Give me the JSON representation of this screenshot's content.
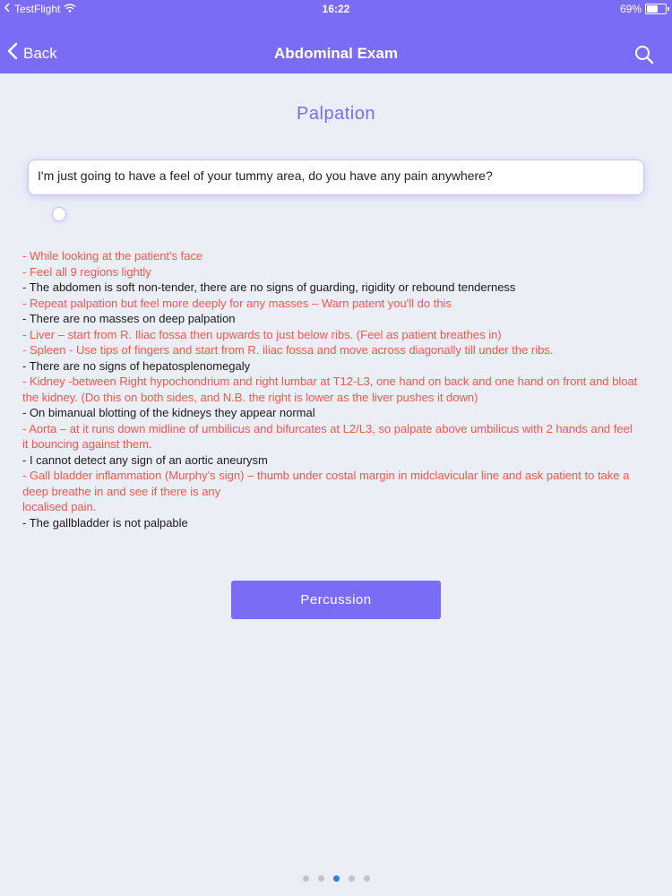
{
  "status_bar": {
    "carrier": "TestFlight",
    "time": "16:22",
    "battery": "69%",
    "battery_level": 0.69
  },
  "nav": {
    "back_label": "Back",
    "title": "Abdominal Exam",
    "search_icon": "search-icon",
    "back_icon": "chevron-left-icon"
  },
  "page": {
    "title": "Palpation",
    "speech": "I'm just going to have a feel of your tummy area, do you have any pain anywhere?"
  },
  "notes": [
    {
      "text": "- While looking at the patient's face",
      "color": "red"
    },
    {
      "text": "- Feel all 9 regions lightly",
      "color": "red"
    },
    {
      "text": "- The abdomen is soft non-tender, there are no signs of guarding, rigidity or rebound tenderness",
      "color": "black"
    },
    {
      "text": "- Repeat palpation but feel more deeply for any masses – Warn patent you'll do this",
      "color": "red"
    },
    {
      "text": "- There are no masses on deep palpation",
      "color": "black"
    },
    {
      "text": "- Liver – start from R. Iliac fossa then upwards to just below ribs. (Feel as patient breathes in)",
      "color": "red"
    },
    {
      "text": "- Spleen - Use tips of fingers and start from R. iliac fossa and move across diagonally till under the ribs.",
      "color": "red"
    },
    {
      "text": "- There are no signs of hepatosplenomegaly",
      "color": "black"
    },
    {
      "text": "- Kidney -between Right hypochondrium and right lumbar at T12-L3, one hand on back and one hand on front and bloat the kidney. (Do this on both sides, and N.B. the right is lower as the liver pushes it down)",
      "color": "red"
    },
    {
      "text": "- On bimanual blotting of the kidneys they appear normal",
      "color": "black"
    },
    {
      "text": "- Aorta – at it runs down midline of umbilicus and bifurcates at L2/L3, so palpate above umbilicus with 2 hands and feel it bouncing against them.",
      "color": "red"
    },
    {
      "text": "- I cannot detect any sign of an aortic aneurysm",
      "color": "black"
    },
    {
      "text": "- Gall bladder inflammation (Murphy's sign) – thumb under costal margin in midclavicular line and ask patient to take a deep breathe in and see if there is any",
      "color": "red"
    },
    {
      "text": "localised pain.",
      "color": "red"
    },
    {
      "text": "- The gallbladder is not palpable",
      "color": "black"
    }
  ],
  "next_button": {
    "label": "Percussion"
  },
  "pager": {
    "count": 5,
    "active_index": 2
  },
  "colors": {
    "accent": "#7b6cf6",
    "note_red": "#f0584c",
    "note_black": "#1a1a1a",
    "pager_active": "#2f7de1"
  }
}
